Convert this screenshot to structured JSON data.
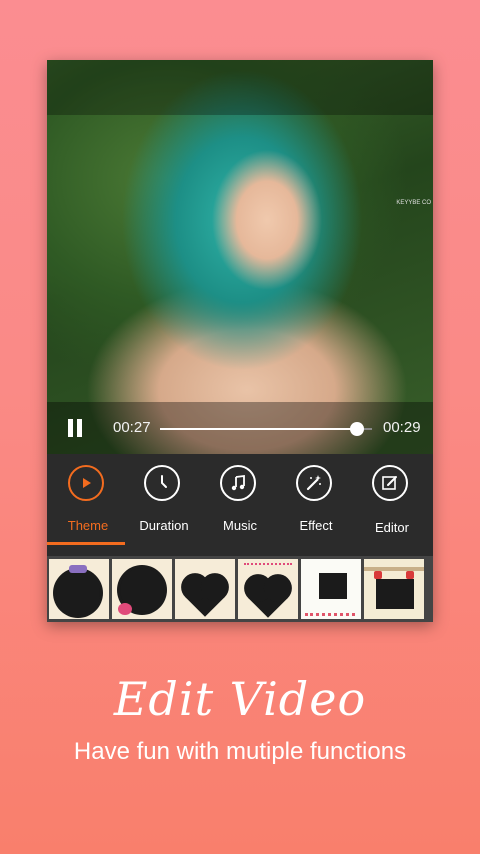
{
  "player": {
    "current_time": "00:27",
    "total_time": "00:29",
    "progress": 0.93,
    "side_mark": "KEYYBE CO"
  },
  "toolbar": {
    "items": [
      {
        "label": "Theme",
        "icon": "play-circle-icon",
        "active": true
      },
      {
        "label": "Duration",
        "icon": "clock-icon",
        "active": false
      },
      {
        "label": "Music",
        "icon": "music-note-icon",
        "active": false
      },
      {
        "label": "Effect",
        "icon": "magic-wand-icon",
        "active": false
      },
      {
        "label": "Editor",
        "icon": "edit-icon",
        "active": false
      }
    ],
    "accent_color": "#f36c1f"
  },
  "themes": [
    {
      "name": "ribbon-scallop-frame"
    },
    {
      "name": "floral-scallop-frame"
    },
    {
      "name": "heart-frame"
    },
    {
      "name": "big-heart-frame"
    },
    {
      "name": "polaroid-frame"
    },
    {
      "name": "bow-photo-frame"
    }
  ],
  "promo": {
    "title": "Edit Video",
    "subtitle": "Have fun with mutiple functions"
  }
}
